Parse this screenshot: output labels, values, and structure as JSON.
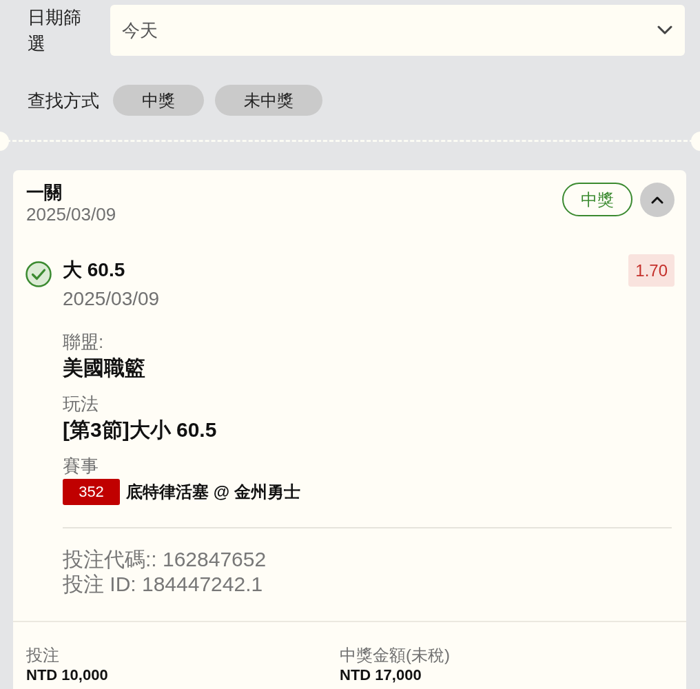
{
  "filters": {
    "date_label": "日期篩選",
    "date_select": {
      "value": "今天"
    },
    "search_label": "查找方式",
    "search_options": [
      {
        "label": "中獎",
        "selected": false
      },
      {
        "label": "未中獎",
        "selected": false
      }
    ]
  },
  "bet": {
    "type": "一關",
    "date": "2025/03/09",
    "status": "中獎",
    "expanded": true,
    "selection": {
      "pick": "大 60.5",
      "date": "2025/03/09",
      "won": true,
      "odds": "1.70",
      "details": [
        {
          "kind": "text",
          "label": "聯盟:",
          "value": "美國職籃"
        },
        {
          "kind": "text",
          "label": "玩法",
          "value": "[第3節]大小 60.5"
        },
        {
          "kind": "event",
          "label": "賽事",
          "event_no": "352",
          "value": "底特律活塞 @ 金州勇士"
        }
      ]
    },
    "codes": [
      "投注代碼:: 162847652",
      "投注 ID: 184447242.1"
    ],
    "summary": [
      {
        "label": "投注",
        "value": "NTD 10,000"
      },
      {
        "label": "中獎金額(未稅)",
        "value": "NTD 17,000"
      }
    ]
  }
}
